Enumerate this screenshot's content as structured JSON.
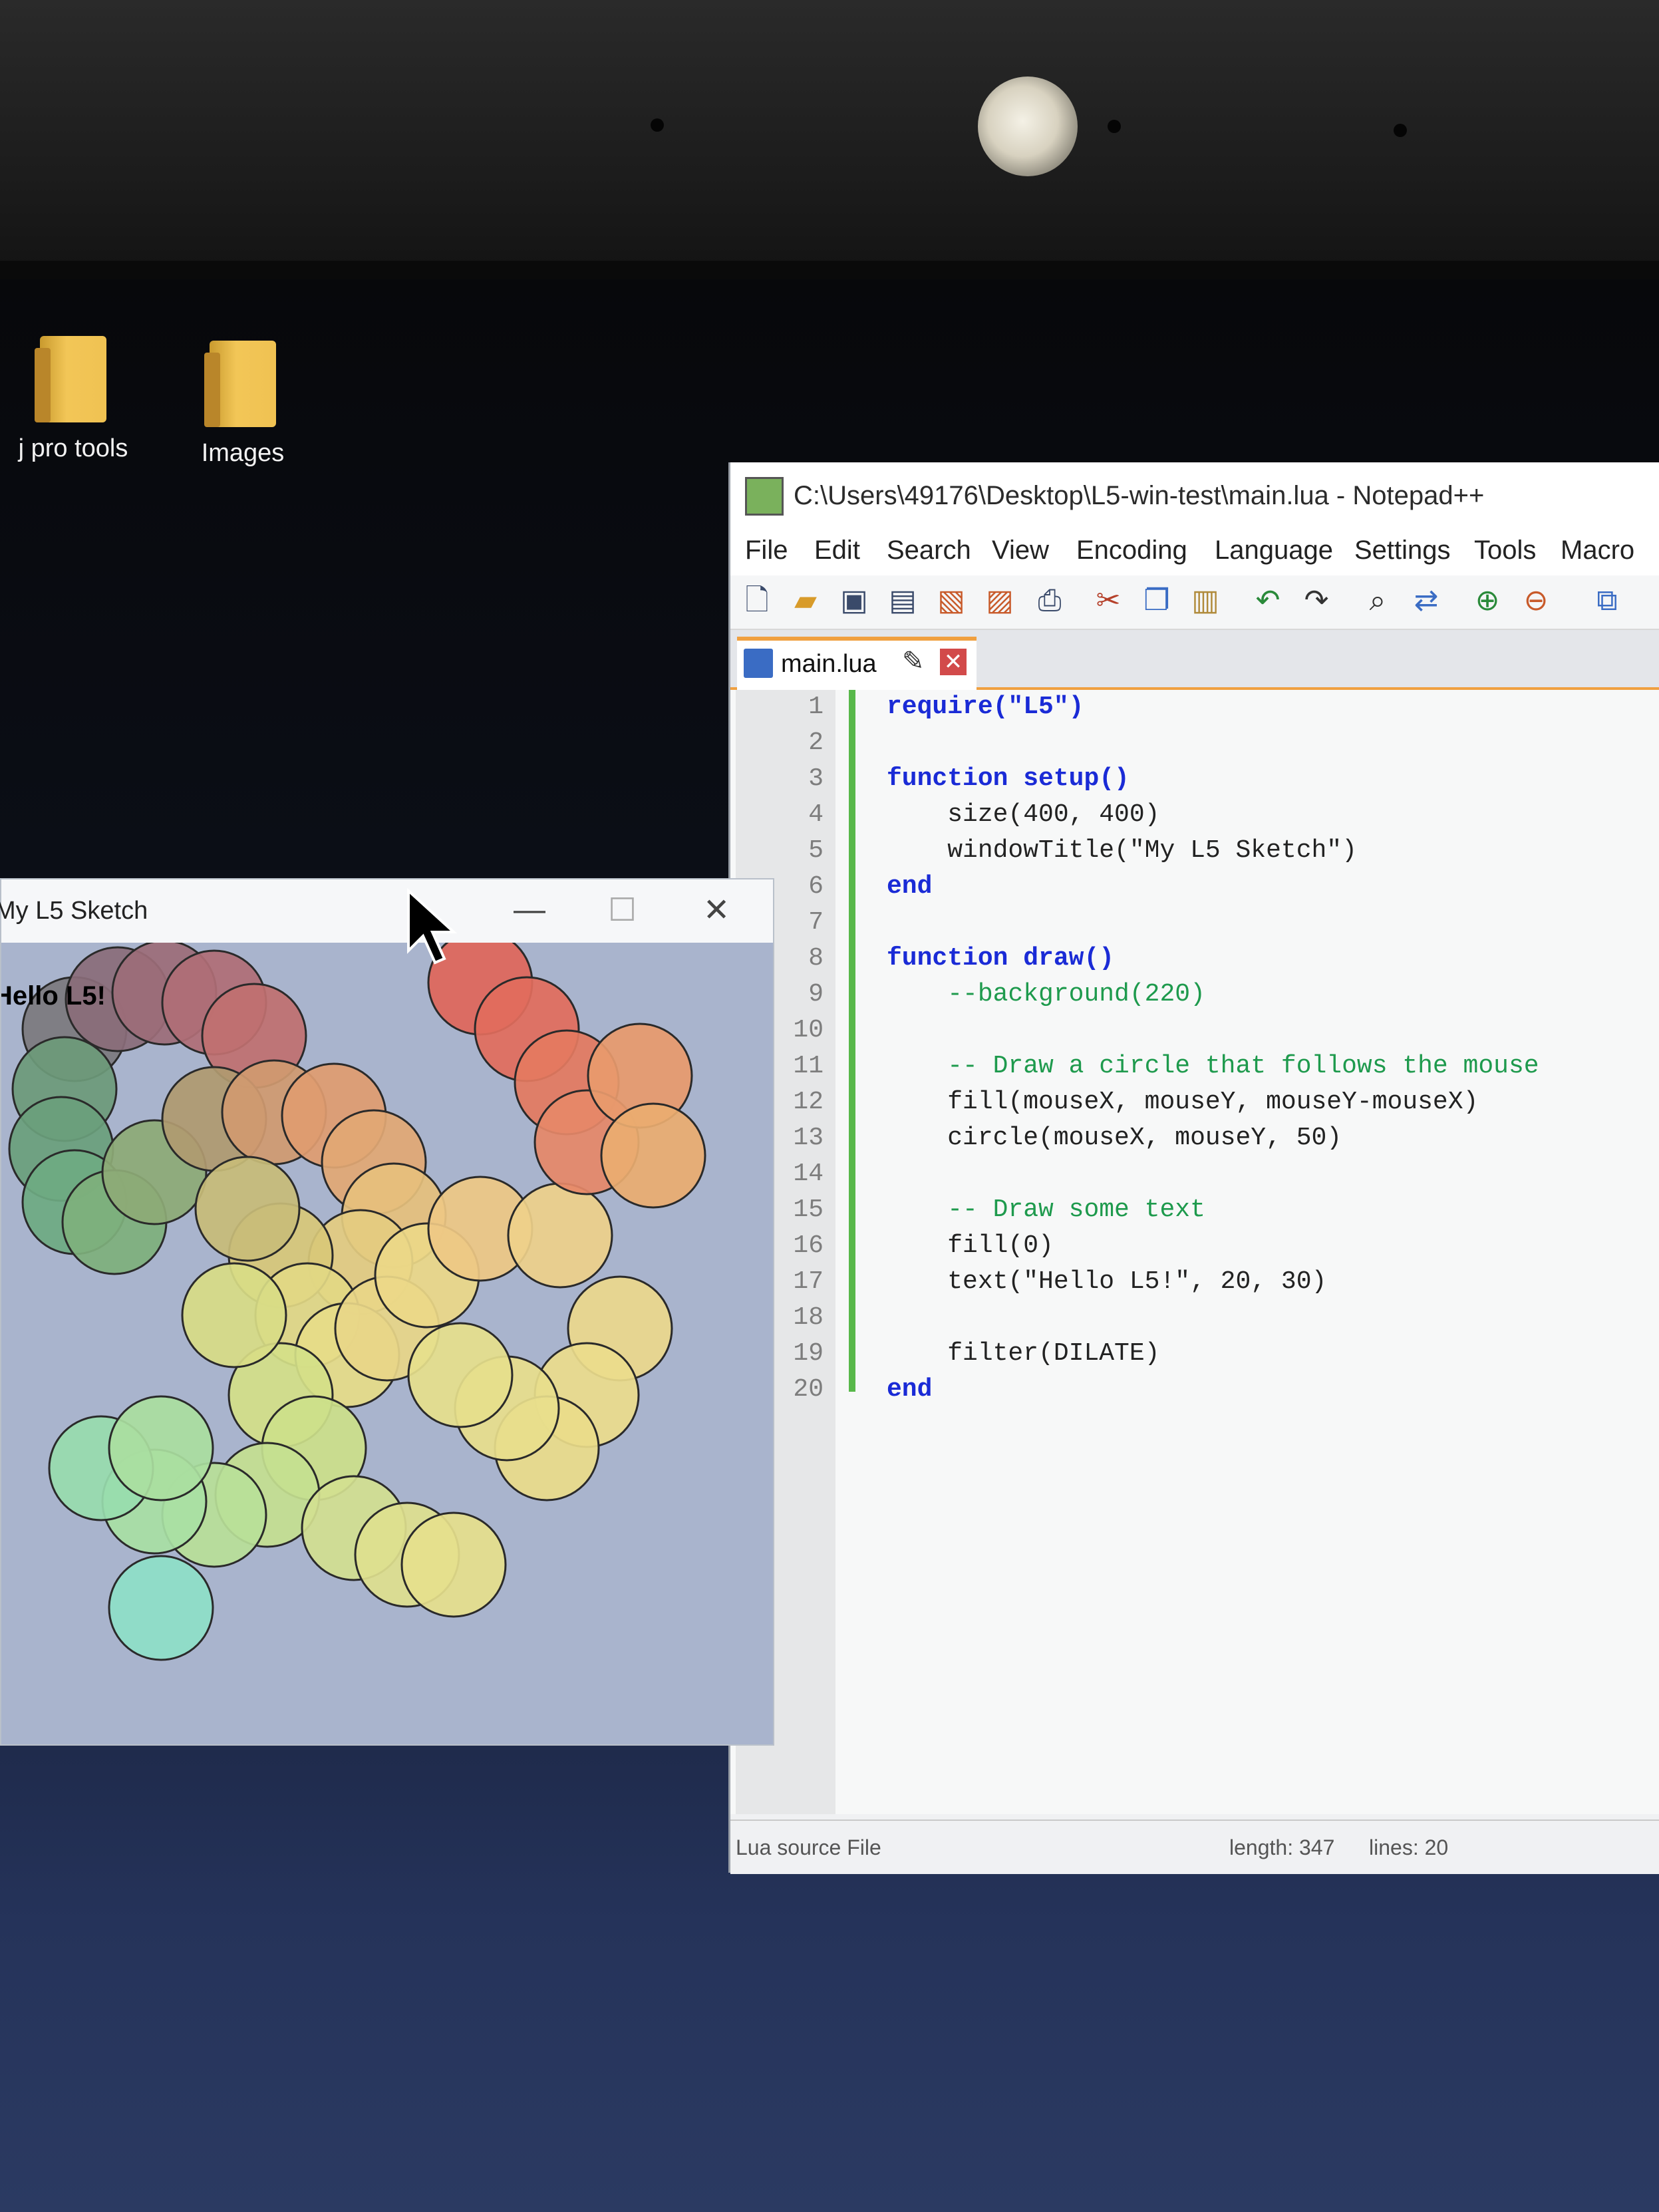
{
  "desktop": {
    "icons": [
      {
        "label": "j pro tools"
      },
      {
        "label": "Images"
      }
    ]
  },
  "notepad": {
    "title": "C:\\Users\\49176\\Desktop\\L5-win-test\\main.lua - Notepad++",
    "menu": [
      "File",
      "Edit",
      "Search",
      "View",
      "Encoding",
      "Language",
      "Settings",
      "Tools",
      "Macro"
    ],
    "toolbar_icons": [
      "new-file-icon",
      "open-file-icon",
      "save-icon",
      "save-all-icon",
      "close-icon",
      "close-all-icon",
      "print-icon",
      "cut-icon",
      "copy-icon",
      "paste-icon",
      "undo-icon",
      "redo-icon",
      "find-icon",
      "replace-icon",
      "zoom-in-icon",
      "zoom-out-icon",
      "sync-icon"
    ],
    "tab": {
      "label": "main.lua",
      "close": "✕"
    },
    "code": [
      {
        "n": "1",
        "text": "require(\"L5\")"
      },
      {
        "n": "2",
        "text": ""
      },
      {
        "n": "3",
        "text": "function setup()"
      },
      {
        "n": "4",
        "text": "    size(400, 400)"
      },
      {
        "n": "5",
        "text": "    windowTitle(\"My L5 Sketch\")"
      },
      {
        "n": "6",
        "text": "end"
      },
      {
        "n": "7",
        "text": ""
      },
      {
        "n": "8",
        "text": "function draw()"
      },
      {
        "n": "9",
        "text": "    --background(220)"
      },
      {
        "n": "10",
        "text": ""
      },
      {
        "n": "11",
        "text": "    -- Draw a circle that follows the mouse"
      },
      {
        "n": "12",
        "text": "    fill(mouseX, mouseY, mouseY-mouseX)"
      },
      {
        "n": "13",
        "text": "    circle(mouseX, mouseY, 50)"
      },
      {
        "n": "14",
        "text": ""
      },
      {
        "n": "15",
        "text": "    -- Draw some text"
      },
      {
        "n": "16",
        "text": "    fill(0)"
      },
      {
        "n": "17",
        "text": "    text(\"Hello L5!\", 20, 30)"
      },
      {
        "n": "18",
        "text": ""
      },
      {
        "n": "19",
        "text": "    filter(DILATE)"
      },
      {
        "n": "20",
        "text": "end"
      }
    ],
    "status": {
      "type": "Lua source File",
      "length": "length: 347",
      "lines": "lines: 20"
    }
  },
  "sketch": {
    "title": "My L5 Sketch",
    "canvas_text": "Hello L5!",
    "buttons": {
      "minimize": "—",
      "maximize": "☐",
      "close": "✕"
    }
  }
}
